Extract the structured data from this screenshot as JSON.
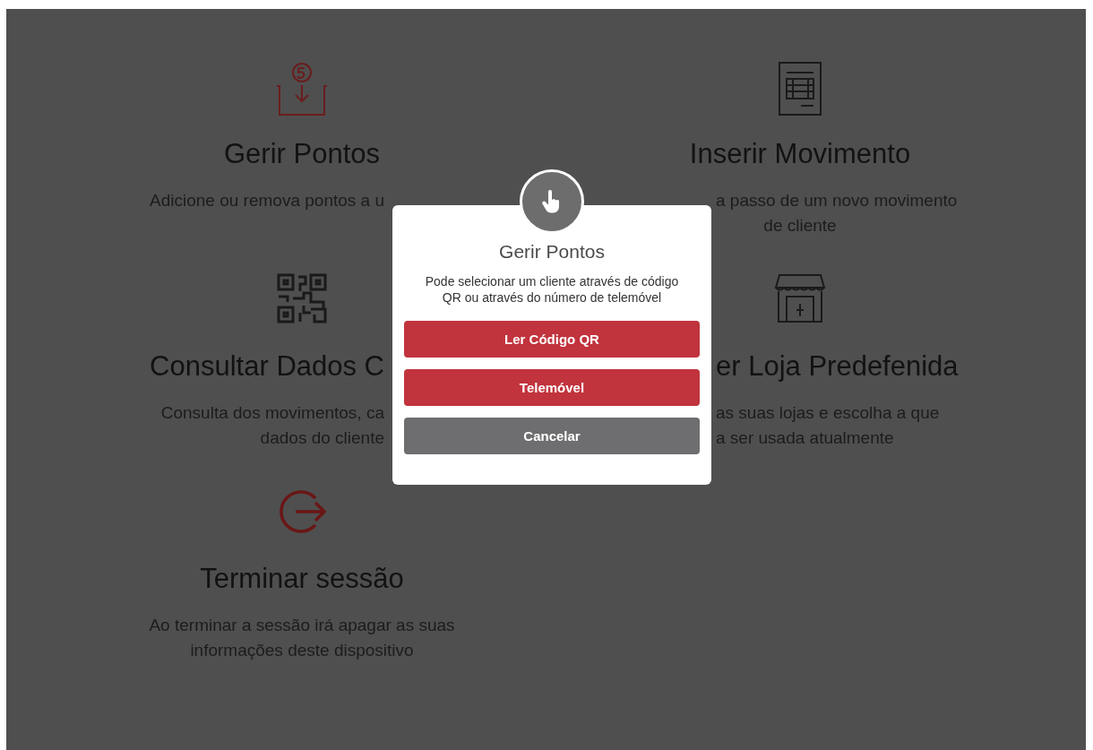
{
  "menu": [
    {
      "title": "Gerir Pontos",
      "description": [
        "Adicione ou remova pontos a u"
      ]
    },
    {
      "title": "Inserir Movimento",
      "description": [
        "a passo de um novo movimento",
        "de cliente"
      ]
    },
    {
      "title": "Consultar Dados C",
      "description": [
        "Consulta dos movimentos, ca",
        "dados do cliente"
      ]
    },
    {
      "title": "er Loja Predefenida",
      "description": [
        "as suas lojas e escolha a que",
        "a ser usada atualmente"
      ]
    },
    {
      "title": "Terminar sessão",
      "description": [
        "Ao terminar a sessão irá apagar as suas",
        "informações deste dispositivo"
      ]
    }
  ],
  "dialog": {
    "title": "Gerir Pontos",
    "message": "Pode selecionar um cliente através de código QR ou através do número de telemóvel",
    "buttons": [
      {
        "label": "Ler Código QR",
        "kind": "primary"
      },
      {
        "label": "Telemóvel",
        "kind": "primary"
      },
      {
        "label": "Cancelar",
        "kind": "cancel"
      }
    ]
  }
}
